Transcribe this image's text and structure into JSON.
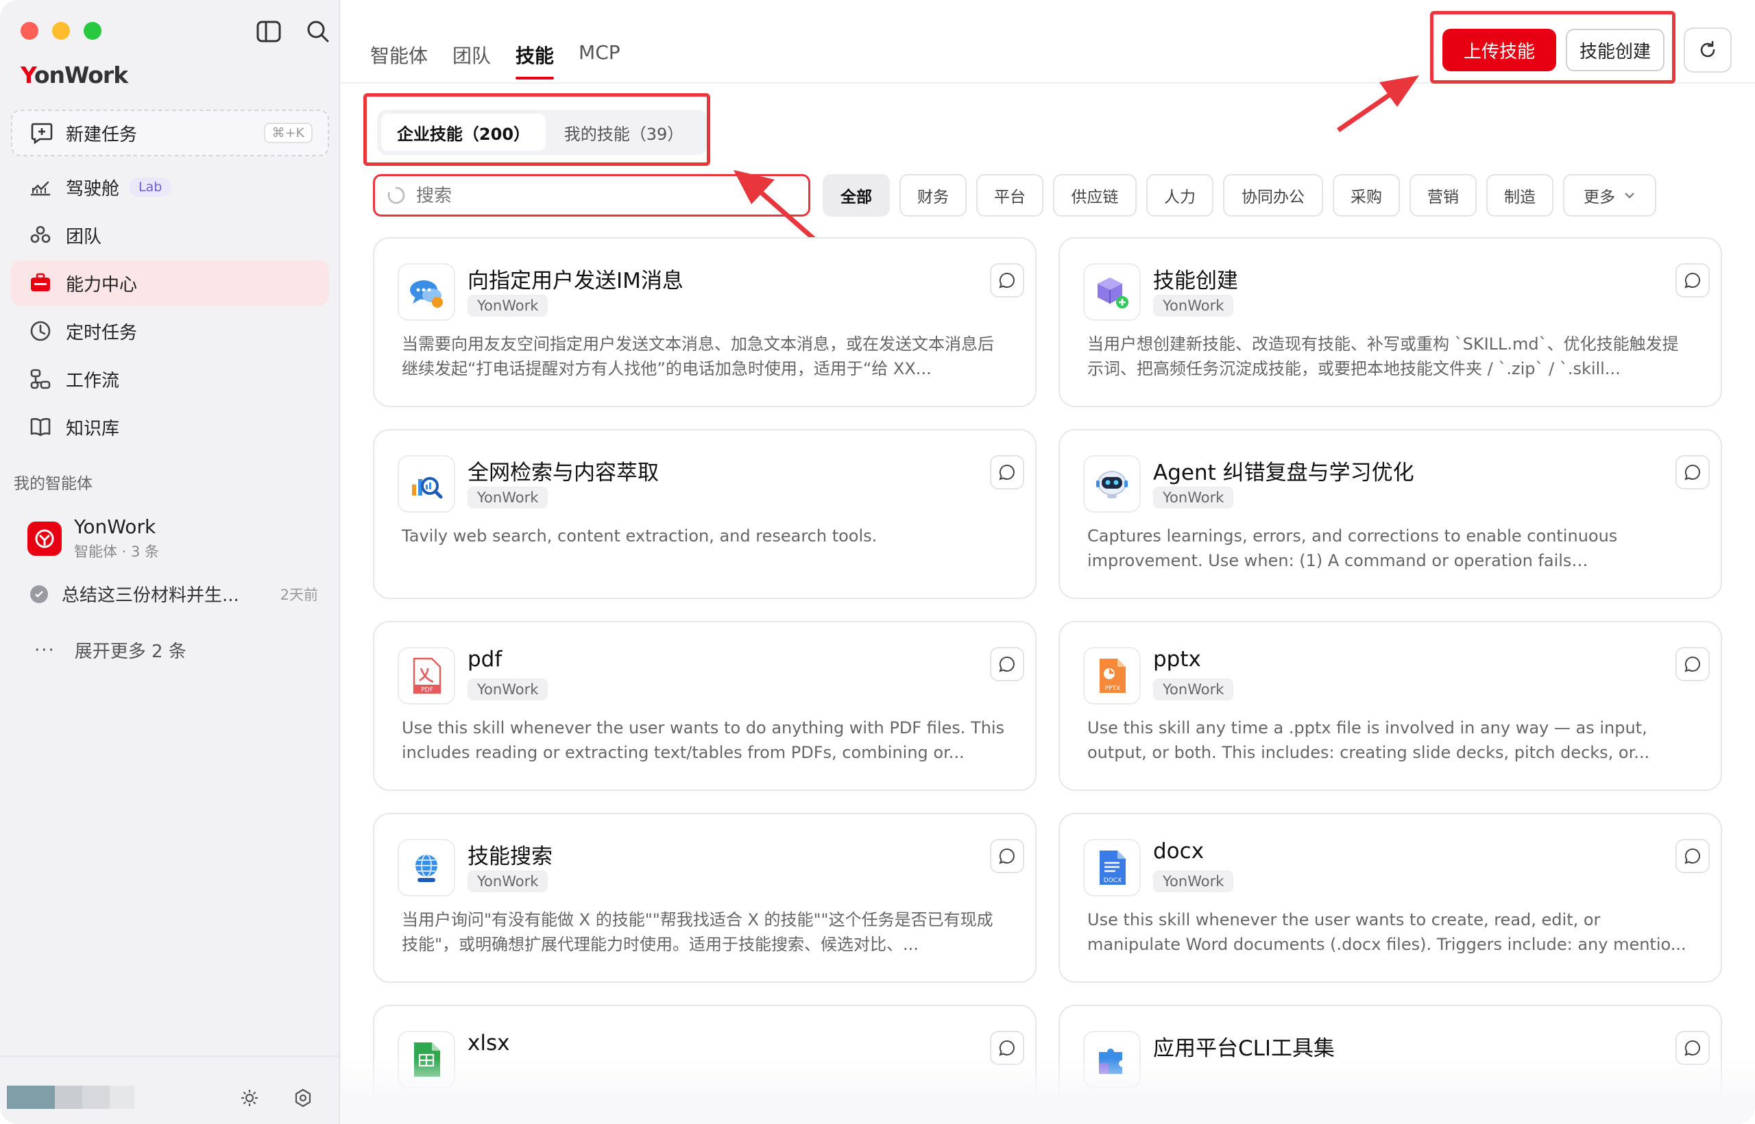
{
  "sidebar": {
    "logo": "YonWork",
    "new_task": {
      "label": "新建任务",
      "shortcut": "⌘+K"
    },
    "nav": [
      {
        "label": "驾驶舱",
        "badge": "Lab",
        "icon": "dashboard-icon"
      },
      {
        "label": "团队",
        "icon": "team-icon"
      },
      {
        "label": "能力中心",
        "icon": "toolbox-icon",
        "active": true
      },
      {
        "label": "定时任务",
        "icon": "clock-icon"
      },
      {
        "label": "工作流",
        "icon": "workflow-icon"
      },
      {
        "label": "知识库",
        "icon": "book-icon"
      }
    ],
    "section_title": "我的智能体",
    "agent": {
      "name": "YonWork",
      "sub": "智能体 · 3 条"
    },
    "history": {
      "title": "总结这三份材料并生...",
      "time": "2天前"
    },
    "more": "展开更多 2 条"
  },
  "main": {
    "tabs": [
      "智能体",
      "团队",
      "技能",
      "MCP"
    ],
    "active_tab": "技能",
    "upload_button": "上传技能",
    "create_button": "技能创建",
    "segments": [
      "企业技能（200）",
      "我的技能（39）"
    ],
    "search_placeholder": "搜索",
    "filters": [
      "全部",
      "财务",
      "平台",
      "供应链",
      "人力",
      "协同办公",
      "采购",
      "营销",
      "制造",
      "更多"
    ]
  },
  "cards": [
    {
      "title": "向指定用户发送IM消息",
      "tag": "YonWork",
      "desc": "当需要向用友友空间指定用户发送文本消息、加急文本消息，或在发送文本消息后继续发起“打电话提醒对方有人找他”的电话加急时使用，适用于“给 XX...",
      "icon": "chat-bubbles-icon"
    },
    {
      "title": "技能创建",
      "tag": "YonWork",
      "desc": "当用户想创建新技能、改造现有技能、补写或重构 `SKILL.md`、优化技能触发提示词、把高频任务沉淀成技能，或要把本地技能文件夹 / `.zip` / `.skill...",
      "icon": "cube-plus-icon"
    },
    {
      "title": "全网检索与内容萃取",
      "tag": "YonWork",
      "desc": "Tavily web search, content extraction, and research tools.",
      "icon": "search-chart-icon"
    },
    {
      "title": "Agent 纠错复盘与学习优化",
      "tag": "YonWork",
      "desc": "Captures learnings, errors, and corrections to enable continuous improvement. Use when: (1) A command or operation fails unexpectedl...",
      "icon": "robot-icon"
    },
    {
      "title": "pdf",
      "tag": "YonWork",
      "desc": "Use this skill whenever the user wants to do anything with PDF files. This includes reading or extracting text/tables from PDFs, combining or...",
      "icon": "pdf-file-icon"
    },
    {
      "title": "pptx",
      "tag": "YonWork",
      "desc": "Use this skill any time a .pptx file is involved in any way — as input, output, or both. This includes: creating slide decks, pitch decks, or...",
      "icon": "pptx-file-icon"
    },
    {
      "title": "技能搜索",
      "tag": "YonWork",
      "desc": "当用户询问\"有没有能做 X 的技能\"\"帮我找适合 X 的技能\"\"这个任务是否已有现成技能\"，或明确想扩展代理能力时使用。适用于技能搜索、候选对比、...",
      "icon": "globe-icon"
    },
    {
      "title": "docx",
      "tag": "YonWork",
      "desc": "Use this skill whenever the user wants to create, read, edit, or manipulate Word documents (.docx files). Triggers include: any mentio...",
      "icon": "docx-file-icon"
    },
    {
      "title": "xlsx",
      "tag": "",
      "desc": "",
      "icon": "xlsx-file-icon"
    },
    {
      "title": "应用平台CLI工具集",
      "tag": "",
      "desc": "",
      "icon": "puzzle-icon"
    }
  ],
  "colors": {
    "accent": "#e60012",
    "highlight": "#e8363c"
  }
}
